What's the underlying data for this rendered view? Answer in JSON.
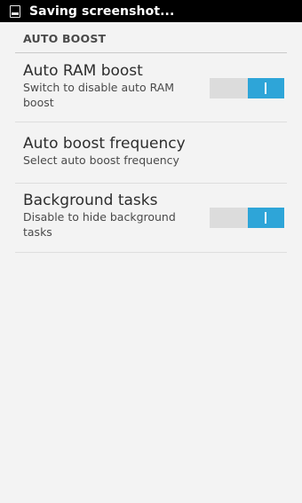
{
  "status_bar": {
    "icon": "screenshot-icon",
    "text": "Saving screenshot..."
  },
  "section": {
    "title": "AUTO BOOST"
  },
  "settings": [
    {
      "title": "Auto RAM boost",
      "subtitle": "Switch to disable auto RAM boost",
      "toggle_on": true
    },
    {
      "title": "Auto boost frequency",
      "subtitle": "Select auto boost frequency"
    },
    {
      "title": "Background tasks",
      "subtitle": "Disable to hide background tasks",
      "toggle_on": true
    }
  ],
  "colors": {
    "accent": "#2ea5d8",
    "toggle_track": "#dcdcdc",
    "background": "#f3f3f3"
  }
}
